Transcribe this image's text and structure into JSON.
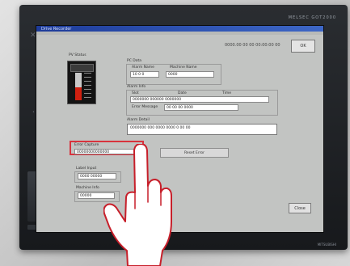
{
  "device": {
    "brand": "MELSEC GOT2000",
    "bottom_label": "MITSUBISHI",
    "icons": [
      "close-icon",
      "navigation-dot-icon"
    ]
  },
  "app": {
    "window_title": "Drive Recorder",
    "top_info": "0000.00 00 00 00:00:00 00",
    "top_button_label": "OK",
    "level_panel": {
      "title": "PV Status",
      "level_percent": 46
    },
    "sections": {
      "info": {
        "title": "PC Data",
        "fields": [
          {
            "label": "Alarm Name",
            "value": "10 0 0"
          },
          {
            "label": "Machine Name",
            "value": "0000"
          }
        ]
      },
      "history": {
        "title": "Alarm Info",
        "headers": [
          "Slot",
          "Date",
          "Time"
        ],
        "row_value": "0000000 000000 0000000",
        "row2_label": "Error Message",
        "row2_value": "00 00 00 0000"
      },
      "message": {
        "title": "Alarm Detail",
        "text": "0000000 000 0000 0000 0 00 00"
      }
    },
    "highlight": {
      "label": "Error Capture",
      "value": "00000000000000"
    },
    "action_button": "Reset Error",
    "lower_group": {
      "label": "Label Input",
      "value": "0000 00000"
    },
    "lower_group2": {
      "label": "Machine Info",
      "value": "00000"
    },
    "close_button": "Close"
  }
}
